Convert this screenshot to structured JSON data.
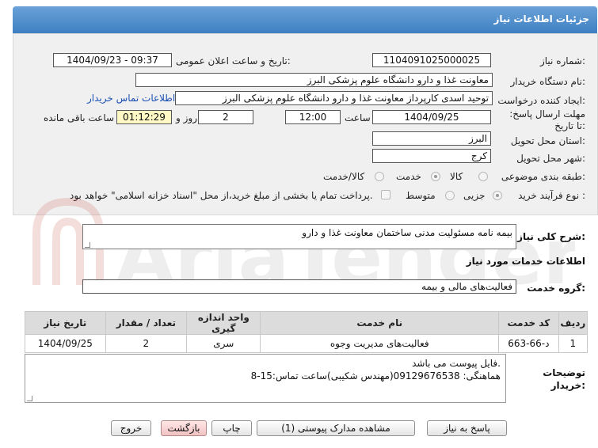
{
  "header": {
    "title": "جزئیات اطلاعات نیاز"
  },
  "form": {
    "need_number_label": "شماره نیاز:",
    "need_number": "1104091025000025",
    "announce_label": "تاریخ و ساعت اعلان عمومی:",
    "announce_value": "1404/09/23 - 09:37",
    "buyer_label": "نام دستگاه خریدار:",
    "buyer_value": "معاونت غذا و دارو دانشگاه علوم پزشکی البرز",
    "creator_label": "ایجاد کننده درخواست:",
    "creator_value": "توحید اسدی کارپرداز معاونت غذا و دارو دانشگاه علوم پزشکی البرز",
    "contact_link": "اطلاعات تماس خریدار",
    "deadline_label": "مهلت ارسال پاسخ: تا تاریخ:",
    "deadline_date": "1404/09/25",
    "time_label": "ساعت",
    "deadline_time": "12:00",
    "days_value": "2",
    "days_label": "روز و",
    "remaining_time": "01:12:29",
    "remaining_label": "ساعت باقی مانده",
    "province_label": "استان محل تحویل:",
    "province_value": "البرز",
    "city_label": "شهر محل تحویل:",
    "city_value": "کرج",
    "category_label": "طبقه بندی موضوعی:",
    "category_options": [
      "کالا",
      "خدمت",
      "کالا/خدمت"
    ],
    "process_label": "نوع فرآیند خرید :",
    "process_options": [
      "جزیی",
      "متوسط"
    ],
    "payment_note": "پرداخت تمام یا بخشی از مبلغ خرید،از محل \"اسناد خزانه اسلامی\" خواهد بود."
  },
  "summary": {
    "label": "شرح کلی نیاز:",
    "value": "بیمه نامه مسئولیت مدنی ساختمان معاونت غذا و دارو"
  },
  "services": {
    "section_title": "اطلاعات خدمات مورد نیاز",
    "group_label": "گروه خدمت:",
    "group_value": "فعالیت‌های مالی و بیمه",
    "columns": [
      "ردیف",
      "کد خدمت",
      "نام خدمت",
      "واحد اندازه گیری",
      "تعداد / مقدار",
      "تاریخ نیاز"
    ],
    "rows": [
      {
        "row": "1",
        "code": "د-66-663",
        "name": "فعالیت‌های مدیریت وجوه",
        "unit": "سری",
        "qty": "2",
        "date": "1404/09/25"
      }
    ]
  },
  "notes": {
    "label": "توضیحات خریدار:",
    "line1": "فایل پیوست می باشد.",
    "line2": "هماهنگی: 09129676538(مهندس شکیبی)ساعت تماس:15-8"
  },
  "buttons": {
    "reply": "پاسخ به نیاز",
    "attachments": "مشاهده مدارک پیوستی (1)",
    "print": "چاپ",
    "back": "بازگشت",
    "exit": "خروج"
  },
  "watermark": {
    "text": "AriaTender.net"
  },
  "colors": {
    "header": "#4f8cc9",
    "link": "#1a4fb3",
    "highlight": "#fdf8c4",
    "watermark": "#c0392b"
  }
}
